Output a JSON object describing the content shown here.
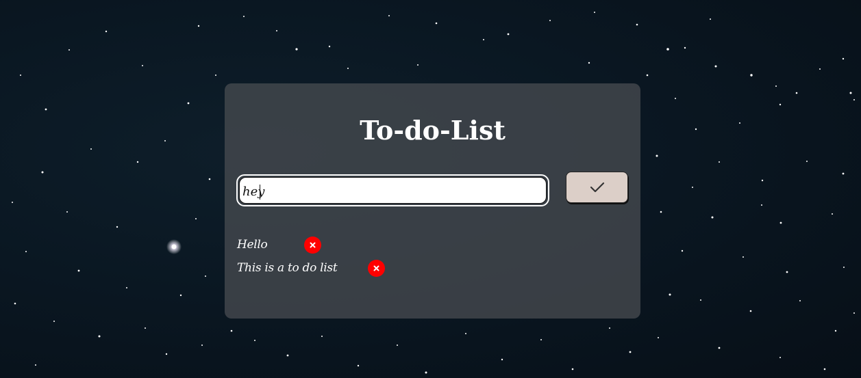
{
  "app": {
    "title": "To-do-List"
  },
  "input": {
    "value": "hey",
    "placeholder": ""
  },
  "add_button": {
    "icon": "checkmark-icon"
  },
  "tasks": [
    {
      "text": "Hello",
      "delete_icon": "close-icon"
    },
    {
      "text": "This is a to do list",
      "delete_icon": "close-icon"
    }
  ],
  "colors": {
    "card": "#464a50",
    "button": "#dccfc8",
    "delete": "#ff0000",
    "text": "#ffffff"
  }
}
